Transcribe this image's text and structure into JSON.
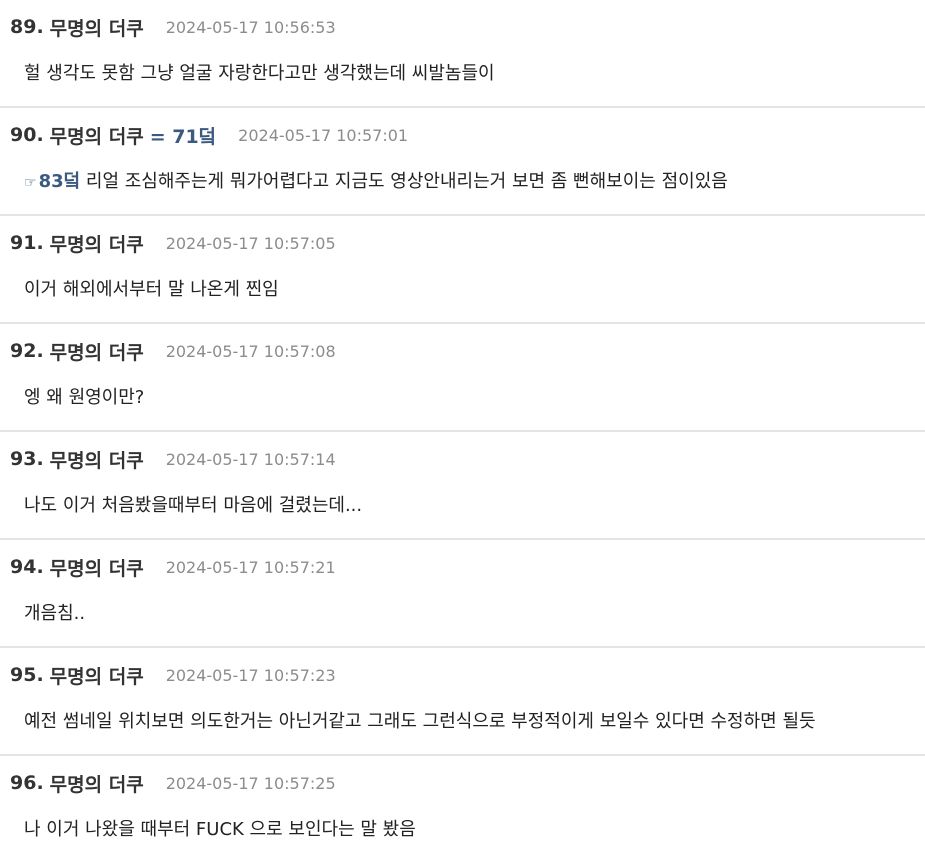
{
  "comments": [
    {
      "num": "89.",
      "author": "무명의 더쿠",
      "time": "2024-05-17 10:56:53",
      "text": "헐 생각도 못함 그냥 얼굴 자랑한다고만 생각했는데 씨발놈들이"
    },
    {
      "num": "90.",
      "author": "무명의 더쿠",
      "ref": "= 71덬",
      "time": "2024-05-17 10:57:01",
      "link_icon": "☞",
      "link": "83덬",
      "text": " 리얼 조심해주는게 뭐가어렵다고 지금도 영상안내리는거 보면 좀 뻔해보이는 점이있음"
    },
    {
      "num": "91.",
      "author": "무명의 더쿠",
      "time": "2024-05-17 10:57:05",
      "text": "이거 해외에서부터 말 나온게 찐임"
    },
    {
      "num": "92.",
      "author": "무명의 더쿠",
      "time": "2024-05-17 10:57:08",
      "text": "엥 왜 원영이만?"
    },
    {
      "num": "93.",
      "author": "무명의 더쿠",
      "time": "2024-05-17 10:57:14",
      "text": "나도 이거 처음봤을때부터 마음에 걸렸는데..."
    },
    {
      "num": "94.",
      "author": "무명의 더쿠",
      "time": "2024-05-17 10:57:21",
      "text": "개음침.."
    },
    {
      "num": "95.",
      "author": "무명의 더쿠",
      "time": "2024-05-17 10:57:23",
      "text": "예전 썸네일 위치보면 의도한거는 아닌거같고 그래도 그런식으로 부정적이게 보일수 있다면 수정하면 될듯"
    },
    {
      "num": "96.",
      "author": "무명의 더쿠",
      "time": "2024-05-17 10:57:25",
      "text": "나 이거 나왔을 때부터 FUCK 으로 보인다는 말 봤음"
    }
  ]
}
